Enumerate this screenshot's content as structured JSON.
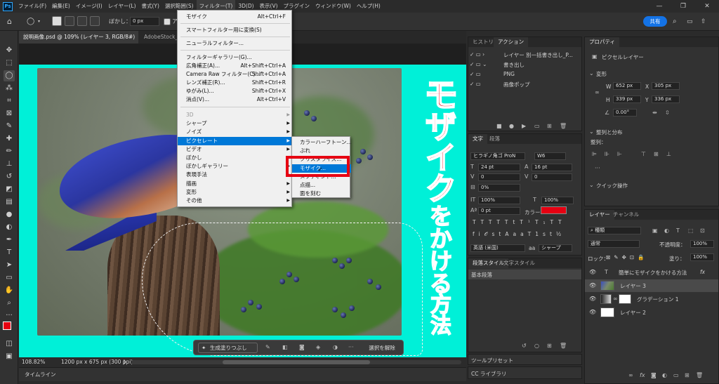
{
  "menubar": {
    "logo": "Ps",
    "items": [
      "ファイル(F)",
      "編集(E)",
      "イメージ(I)",
      "レイヤー(L)",
      "書式(Y)",
      "選択範囲(S)",
      "フィルター(T)",
      "3D(D)",
      "表示(V)",
      "プラグイン",
      "ウィンドウ(W)",
      "ヘルプ(H)"
    ],
    "active": "フィルター(T)",
    "window_controls": [
      "—",
      "❐",
      "✕"
    ]
  },
  "optbar": {
    "feather_label": "ぼかし：",
    "feather_value": "0 px",
    "antialias_label": "ア",
    "share_label": "共有"
  },
  "doctabs": {
    "active": "説明画像.psd @ 109% (レイヤー 3, RGB/8#)",
    "inactive": "AdobeStock_"
  },
  "filter_menu": {
    "items": [
      {
        "label": "モザイク",
        "shortcut": "Alt+Ctrl+F"
      },
      {
        "sep": true
      },
      {
        "label": "スマートフィルター用に変換(S)"
      },
      {
        "sep": true
      },
      {
        "label": "ニューラルフィルター..."
      },
      {
        "sep": true
      },
      {
        "label": "フィルターギャラリー(G)..."
      },
      {
        "label": "広角補正(A)...",
        "shortcut": "Alt+Shift+Ctrl+A"
      },
      {
        "label": "Camera Raw フィルター(C)...",
        "shortcut": "Shift+Ctrl+A"
      },
      {
        "label": "レンズ補正(R)...",
        "shortcut": "Shift+Ctrl+R"
      },
      {
        "label": "ゆがみ(L)...",
        "shortcut": "Shift+Ctrl+X"
      },
      {
        "label": "消点(V)...",
        "shortcut": "Alt+Ctrl+V"
      },
      {
        "sep": true
      },
      {
        "label": "3D",
        "submenu": true,
        "disabled": true
      },
      {
        "label": "シャープ",
        "submenu": true
      },
      {
        "label": "ノイズ",
        "submenu": true
      },
      {
        "label": "ピクセレート",
        "submenu": true,
        "highlighted": true
      },
      {
        "label": "ビデオ",
        "submenu": true
      },
      {
        "label": "ぼかし",
        "submenu": true
      },
      {
        "label": "ぼかしギャラリー",
        "submenu": true
      },
      {
        "label": "表現手法",
        "submenu": true
      },
      {
        "label": "描画",
        "submenu": true
      },
      {
        "label": "変形",
        "submenu": true
      },
      {
        "label": "その他",
        "submenu": true
      }
    ]
  },
  "pixelate_submenu": {
    "items": [
      {
        "label": "カラーハーフトーン..."
      },
      {
        "label": "ぶれ"
      },
      {
        "label": "クリスタライズ..."
      },
      {
        "label": "モザイク...",
        "highlighted": true
      },
      {
        "label": "メゾティント..."
      },
      {
        "label": "点描..."
      },
      {
        "label": "面を刻む"
      }
    ]
  },
  "canvas": {
    "title_chars": [
      "モ",
      "ザ",
      "イ",
      "ク",
      "を",
      "か",
      "け",
      "る",
      "方",
      "法"
    ],
    "title_colors": {
      "primary": "#e60012",
      "secondary": "#111111",
      "outline": "#ffffff"
    },
    "bg_color": "#00f0d8",
    "context_bar": {
      "generative_fill": "生成塗りつぶし",
      "deselect": "選択を解除"
    }
  },
  "statusbar": {
    "zoom": "108.82%",
    "doc_info": "1200 px x 675 px (300 ppi)"
  },
  "timeline": {
    "label": "タイムライン"
  },
  "history_actions_panel": {
    "tabs": [
      "ヒストリー",
      "アクション"
    ],
    "active_tab": "アクション",
    "rows": [
      {
        "label": "レイヤー 別一括書き出し_P..."
      },
      {
        "label": "書き出し"
      },
      {
        "label": "PNG"
      },
      {
        "label": "画像ポップ"
      }
    ]
  },
  "character_panel": {
    "tabs": [
      "文字",
      "段落"
    ],
    "font": "ヒラギノ角ゴ ProN",
    "weight": "W6",
    "size": "24 pt",
    "leading": "16 pt",
    "kerning": "0",
    "tracking": "0",
    "tsume": "0%",
    "vscale": "100%",
    "hscale": "100%",
    "baseline": "0 pt",
    "color_label": "カラー：",
    "color_value": "#e60012",
    "style_buttons": [
      "T",
      "T",
      "TT",
      "Tt",
      "T¹",
      "T₁",
      "T",
      "T"
    ],
    "opentype_buttons": [
      "fi",
      "𝒪",
      "st",
      "A",
      "aa",
      "T",
      "1st",
      "½"
    ],
    "language": "英語 (米国)",
    "aa": "aa",
    "antialias": "シャープ"
  },
  "paragraph_styles_panel": {
    "tabs": [
      "段落スタイル",
      "文字スタイル"
    ],
    "row": "基本段落"
  },
  "tool_presets": {
    "label": "ツールプリセット"
  },
  "cc_libraries": {
    "label": "CC ライブラリ"
  },
  "properties_panel": {
    "tab": "プロパティ",
    "header": "ピクセルレイヤー",
    "transform_label": "変形",
    "w_label": "W",
    "w_value": "652 px",
    "x_label": "X",
    "x_value": "305 px",
    "h_label": "H",
    "h_value": "339 px",
    "y_label": "Y",
    "y_value": "336 px",
    "angle_value": "0.00°",
    "align_label": "整列と分布",
    "align_sub": "整列：",
    "quick_actions": "クイック操作"
  },
  "layers_panel": {
    "tabs": [
      "レイヤー",
      "チャンネル"
    ],
    "filter_kind": "種類",
    "blend_mode": "通常",
    "opacity_label": "不透明度：",
    "opacity_value": "100%",
    "lock_label": "ロック：",
    "fill_label": "塗り：",
    "fill_value": "100%",
    "layers": [
      {
        "name": "簡単にモザイクをかける方法",
        "type": "text",
        "fx": "fx"
      },
      {
        "name": "レイヤー 3",
        "type": "pixel",
        "selected": true
      },
      {
        "name": "グラデーション 1",
        "type": "gradient"
      },
      {
        "name": "レイヤー 2",
        "type": "pixel"
      }
    ]
  }
}
